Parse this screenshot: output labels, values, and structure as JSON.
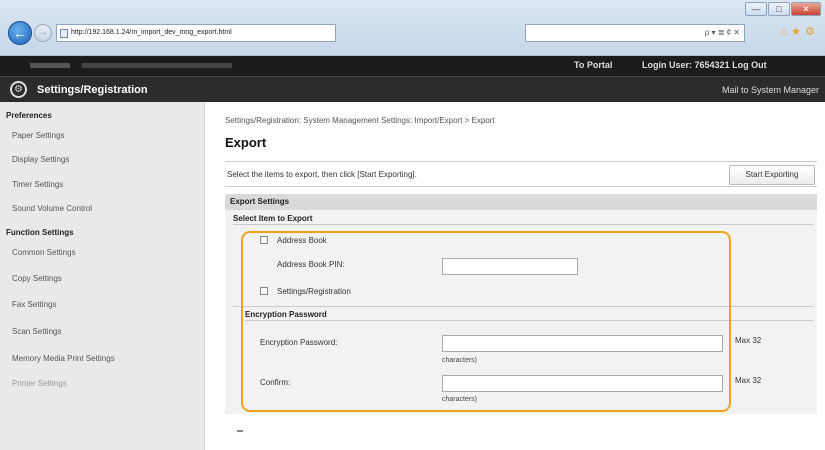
{
  "browser": {
    "address": "http://192.168.1.24/m_import_dev_mng_export.html",
    "toolbar_glyphs": "ρ ▾ ≣ ¢ ✕",
    "window_controls": [
      "—",
      "□",
      "✕"
    ]
  },
  "header": {
    "to_portal": "To Portal",
    "login_label": "Login User:",
    "login_user": "7654321",
    "log_out": "Log Out",
    "app_title": "Settings/Registration",
    "mail_link": "Mail to System Manager"
  },
  "sidebar": {
    "sections": [
      {
        "title": "Preferences",
        "items": [
          "Paper Settings",
          "Display Settings",
          "Timer Settings",
          "Sound Volume Control"
        ]
      },
      {
        "title": "Function Settings",
        "items": [
          "Common Settings",
          "Copy Settings",
          "Fax Settings",
          "Scan Settings",
          "Memory Media Print Settings",
          "Printer Settings"
        ]
      }
    ]
  },
  "main": {
    "breadcrumb": "Settings/Registration: System Management Settings: Import/Export > Export",
    "title": "Export",
    "instruction": "Select the items to export, then click [Start Exporting].",
    "start_button": "Start Exporting",
    "panel_title": "Export Settings",
    "select_heading": "Select Item to Export",
    "address_book": "Address Book",
    "address_book_pin": "Address Book PIN:",
    "settings_registration": "Settings/Registration",
    "encryption_heading": "Encryption Password",
    "encryption_password": "Encryption Password:",
    "confirm": "Confirm:",
    "max_hint": "Max 32",
    "characters_hint": "characters)"
  },
  "colors": {
    "highlight": "#f0a21a",
    "header_dark": "#1c1c1c",
    "sidebar_bg": "#e9e9e9"
  }
}
